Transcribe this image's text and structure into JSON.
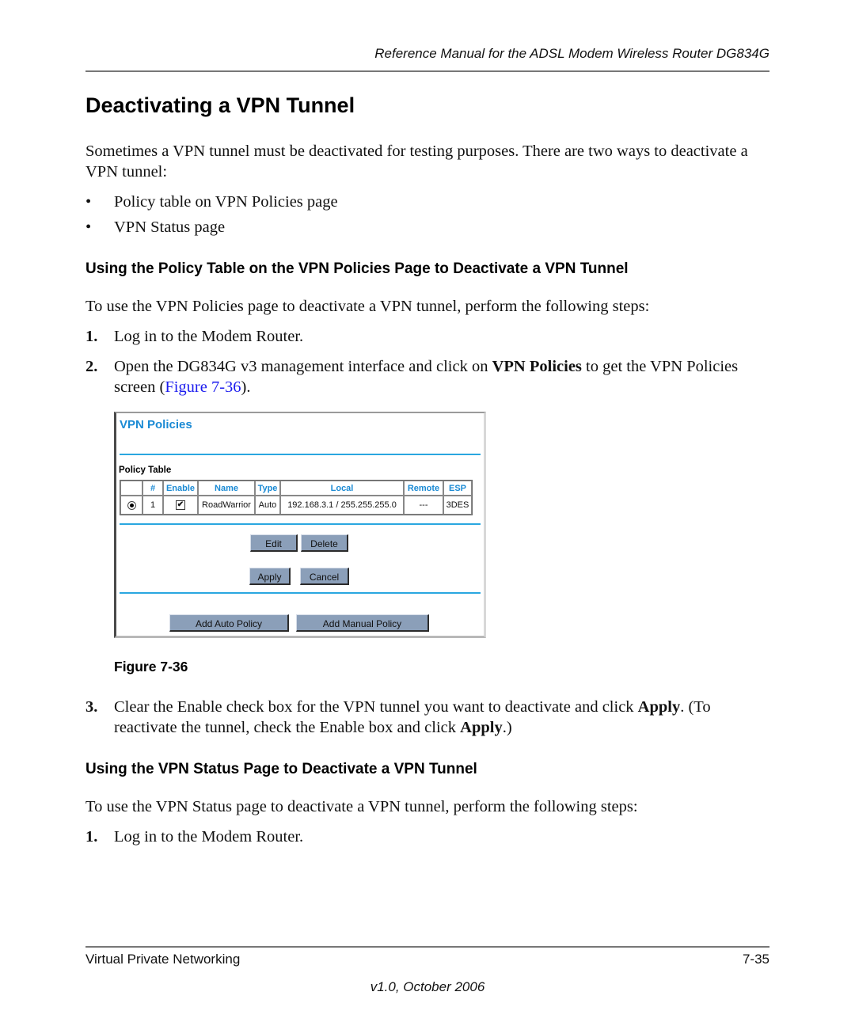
{
  "header": {
    "running_title": "Reference Manual for the ADSL Modem Wireless Router DG834G"
  },
  "title": "Deactivating a VPN Tunnel",
  "intro": "Sometimes a VPN tunnel must be deactivated for testing purposes. There are two ways to deactivate a VPN tunnel:",
  "bullets": [
    "Policy table on VPN Policies page",
    "VPN Status page"
  ],
  "bullet_glyph": "•",
  "section1": {
    "heading": "Using the Policy Table on the VPN Policies Page to Deactivate a VPN Tunnel",
    "intro": "To use the VPN Policies page to deactivate a VPN tunnel, perform the following steps:",
    "steps": [
      {
        "num": "1.",
        "text": "Log in to the Modem Router."
      },
      {
        "num": "2.",
        "pre": "Open the DG834G v3 management interface and click on ",
        "bold": "VPN Policies",
        "post1": " to get the VPN Policies screen (",
        "link": "Figure 7-36",
        "post2": ")."
      },
      {
        "num": "3.",
        "pre": "Clear the Enable check box for the VPN tunnel you want to deactivate and click ",
        "bold1": "Apply",
        "mid": ". (To reactivate the tunnel, check the Enable box and click ",
        "bold2": "Apply",
        "post": ".)"
      }
    ]
  },
  "figure": {
    "caption": "Figure 7-36",
    "ui": {
      "title": "VPN Policies",
      "table_label": "Policy Table",
      "columns": [
        "",
        "#",
        "Enable",
        "Name",
        "Type",
        "Local",
        "Remote",
        "ESP"
      ],
      "rows": [
        {
          "selected": true,
          "num": "1",
          "enabled": true,
          "name": "RoadWarrior",
          "type": "Auto",
          "local": "192.168.3.1 / 255.255.255.0",
          "remote": "---",
          "esp": "3DES"
        }
      ],
      "check_glyph": "✔",
      "buttons": {
        "edit": "Edit",
        "delete": "Delete",
        "apply": "Apply",
        "cancel": "Cancel",
        "add_auto": "Add Auto Policy",
        "add_manual": "Add Manual Policy"
      },
      "accent_color": "#1a8ad4",
      "button_color": "#8b9fb9"
    }
  },
  "section2": {
    "heading": "Using the VPN Status Page to Deactivate a VPN Tunnel",
    "intro": "To use the VPN Status page to deactivate a VPN tunnel, perform the following steps:",
    "steps": [
      {
        "num": "1.",
        "text": "Log in to the Modem Router."
      }
    ]
  },
  "footer": {
    "chapter": "Virtual Private Networking",
    "page": "7-35",
    "version": "v1.0, October 2006"
  }
}
